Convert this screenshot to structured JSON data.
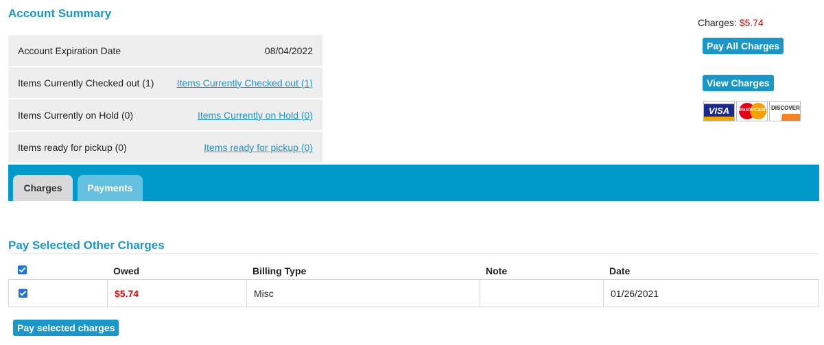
{
  "account_summary": {
    "title": "Account Summary",
    "rows": [
      {
        "label": "Account Expiration Date",
        "value": "08/04/2022"
      },
      {
        "label": "Items Currently Checked out (1)",
        "link": "Items Currently Checked out (1)"
      },
      {
        "label": "Items Currently on Hold (0)",
        "link": "Items Currently on Hold (0)"
      },
      {
        "label": "Items ready for pickup (0)",
        "link": "Items ready for pickup (0)"
      }
    ]
  },
  "charges_panel": {
    "label": "Charges:",
    "amount": "$5.74",
    "pay_all_label": "Pay All Charges",
    "view_charges_label": "View Charges",
    "cards": [
      "VISA",
      "MasterCard",
      "DISCOVER"
    ]
  },
  "tabs": [
    {
      "label": "Charges",
      "active": true
    },
    {
      "label": "Payments",
      "active": false
    }
  ],
  "other_charges": {
    "title": "Pay Selected Other Charges",
    "columns": [
      "Owed",
      "Billing Type",
      "Note",
      "Date"
    ],
    "rows": [
      {
        "checked": true,
        "owed": "$5.74",
        "billing_type": "Misc",
        "note": "",
        "date": "01/26/2021"
      }
    ],
    "pay_selected_label": "Pay selected charges"
  },
  "colors": {
    "accent": "#1a96c8",
    "tabbar": "#0099cc",
    "amount": "#e00000"
  }
}
